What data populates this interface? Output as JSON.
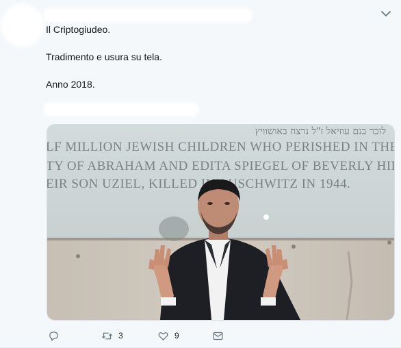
{
  "tweet": {
    "lines": [
      "Il Criptogiudeo.",
      "Tradimento e usura su tela.",
      "Anno 2018."
    ],
    "image": {
      "wall_lines": [
        "לזכר בנם עוזיאל ז\"ל נרצח באושוויץ",
        "LF MILLION JEWISH CHILDREN WHO PERISHED IN THE",
        "TY OF ABRAHAM AND EDITA SPIEGEL OF BEVERLY HILL",
        "EIR SON UZIEL, KILLED IN AUSCHWITZ IN 1944."
      ]
    },
    "actions": {
      "reply_icon": "speech-bubble",
      "retweet_icon": "retweet-arrows",
      "retweet_count": "3",
      "like_icon": "heart",
      "like_count": "9",
      "dm_icon": "envelope"
    }
  },
  "colors": {
    "background": "#f5f8fa",
    "text": "#14171a",
    "secondary": "#657786"
  }
}
